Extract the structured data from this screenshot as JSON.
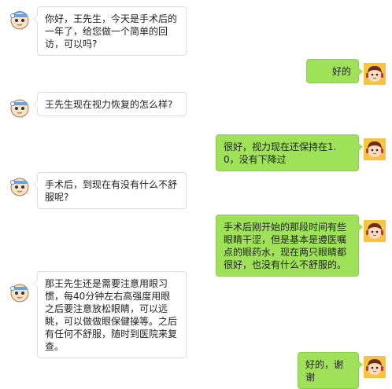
{
  "messages": [
    {
      "side": "left",
      "text": "你好，王先生，今天是手术后的一年了，给您做一个简单的回访，可以吗?"
    },
    {
      "side": "right",
      "text": "好的"
    },
    {
      "side": "left",
      "text": "王先生现在视力恢复的怎么样?"
    },
    {
      "side": "right",
      "text": "很好，视力现在还保持在1.0，没有下降过"
    },
    {
      "side": "left",
      "text": "手术后，到现在有没有什么不舒服呢?"
    },
    {
      "side": "right",
      "text": "手术后刚开始的那段时间有些眼睛干涩，但是基本是遵医嘱点的眼药水，现在两只眼睛都很好，也没有什么不舒服的。"
    },
    {
      "side": "left",
      "text": "那王先生还是需要注意用眼习惯，每40分钟左右高强度用眼之后要注意放松眼睛，可以远眺，可以做做眼保健操等。之后有任何不舒服，随时到医院来复查。"
    },
    {
      "side": "right",
      "text": "好的，谢谢"
    }
  ],
  "avatars": {
    "staff": "cartoon-doctor-avatar",
    "patient": "cartoon-headset-avatar"
  },
  "colors": {
    "left_bubble": "#ffffff",
    "left_border": "#dcdcdc",
    "right_bubble": "#9fe25a",
    "right_border": "#8ccd4a"
  }
}
